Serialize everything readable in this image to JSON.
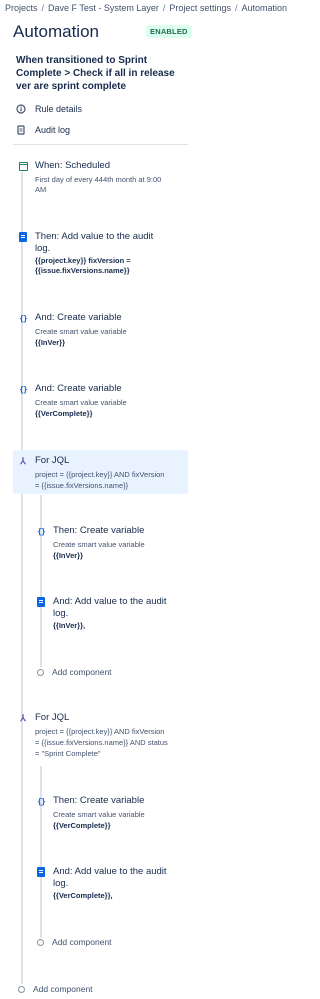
{
  "breadcrumb": [
    "Projects",
    "Dave F Test - System Layer",
    "Project settings",
    "Automation"
  ],
  "page_title": "Automation",
  "status_badge": "ENABLED",
  "rule_name": "When transitioned to Sprint Complete > Check if all in release ver are sprint complete",
  "nav": {
    "rule_details": "Rule details",
    "audit_log": "Audit log"
  },
  "steps": {
    "trigger": {
      "title": "When: Scheduled",
      "desc1": "First day of every 444th month at 9:00",
      "desc2": "AM"
    },
    "audit1": {
      "title1": "Then: Add value to the audit",
      "title2": "log.",
      "bold1": "{{project.key}} fixVersion =",
      "bold2": "{{issue.fixVersions.name}}"
    },
    "var1": {
      "title": "And: Create variable",
      "desc": "Create smart value variable",
      "bold": "{{InVer}}"
    },
    "var2": {
      "title": "And: Create variable",
      "desc": "Create smart value variable",
      "bold": "{{VerComplete}}"
    },
    "jql1": {
      "title": "For JQL",
      "desc1": "project = {{project.key}} AND fixVersion",
      "desc2": "= {{issue.fixVersions.name}}"
    },
    "jql1_var": {
      "title": "Then: Create variable",
      "desc": "Create smart value variable",
      "bold": "{{InVer}}"
    },
    "jql1_audit": {
      "title1": "And: Add value to the audit",
      "title2": "log.",
      "bold": "{{InVer}},"
    },
    "jql1_add": "Add component",
    "jql2": {
      "title": "For JQL",
      "desc1": "project = {{project.key}} AND fixVersion",
      "desc2": "= {{issue.fixVersions.name}} AND status",
      "desc3": "= \"Sprint Complete\""
    },
    "jql2_var": {
      "title": "Then: Create variable",
      "desc": "Create smart value variable",
      "bold": "{{VerComplete}}"
    },
    "jql2_audit": {
      "title1": "And: Add value to the audit",
      "title2": "log.",
      "bold": "{{VerComplete}},"
    },
    "jql2_add": "Add component",
    "main_add": "Add component"
  },
  "colors": {
    "trigger_icon": "#1f845a",
    "action_icon": "#0c66e4",
    "branch_icon": "#5e4db2",
    "badge_bg": "#dcfff1",
    "badge_text": "#216e4e",
    "highlight_bg": "#e9f2ff"
  },
  "icons": {
    "rule_details": "info-icon",
    "audit_log": "document-icon",
    "trigger": "calendar-icon",
    "audit": "document-icon",
    "variable": "curly-braces-icon",
    "branch": "branch-icon"
  }
}
